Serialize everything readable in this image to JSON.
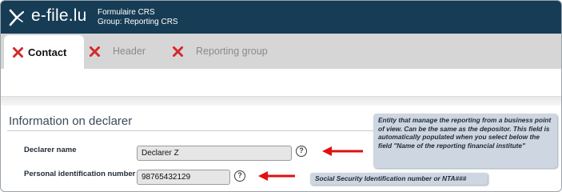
{
  "header": {
    "brand": "e-file.lu",
    "form_title": "Formulaire CRS",
    "form_group": "Group: Reporting CRS",
    "logo_icon": "efile-logo-icon",
    "background_color": "#173c55"
  },
  "tabs": [
    {
      "label": "Contact",
      "icon": "error-x-icon",
      "active": true
    },
    {
      "label": "Header",
      "icon": "error-x-icon",
      "active": false
    },
    {
      "label": "Reporting group",
      "icon": "error-x-icon",
      "active": false
    }
  ],
  "section": {
    "title": "Information on declarer"
  },
  "fields": {
    "declarer_name": {
      "label": "Declarer name",
      "value": "Declarer Z",
      "help_icon": "help-question-icon"
    },
    "personal_id": {
      "label": "Personal identification number",
      "value": "98765432129",
      "help_icon": "help-question-icon"
    }
  },
  "tooltips": {
    "declarer_name": "Entity that manage the reporting from a business point of view. Can be the same as the depositor. This field is automatically populated when you select below the field \"Name of the reporting financial institute\"",
    "personal_id": "Social Security Identification number or NTA###"
  },
  "colors": {
    "error_red": "#d42a2a",
    "arrow_red": "#e01010",
    "tooltip_bg": "#cdd6e1"
  }
}
